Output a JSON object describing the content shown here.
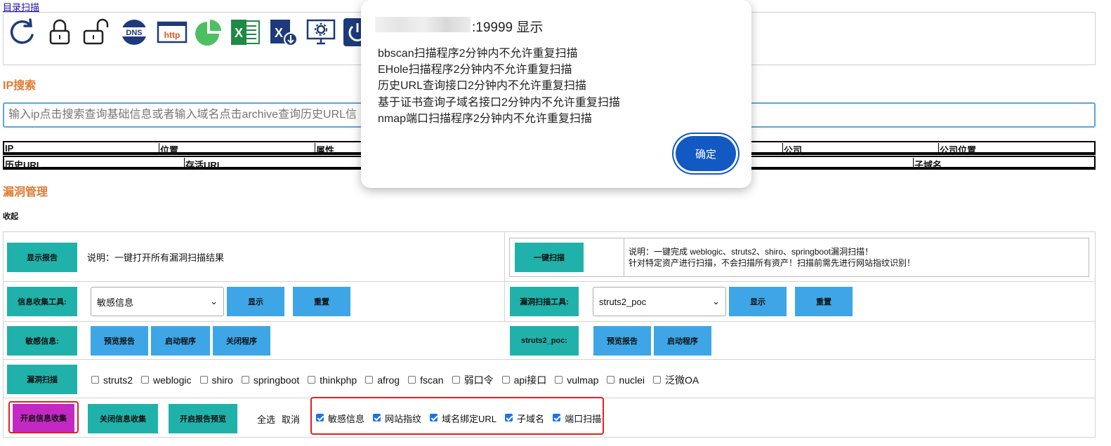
{
  "top_link": "目录扫描",
  "icons": [
    "refresh-icon",
    "unlock-icon",
    "unlock-open-icon",
    "dns-icon",
    "http-icon",
    "pie-chart-icon",
    "excel-icon",
    "excel-export-icon",
    "monitor-settings-icon",
    "power-icon"
  ],
  "ip_search": {
    "title": "IP搜索",
    "placeholder": "输入ip点击搜索查询基础信息或者输入域名点击archive查询历史URL信"
  },
  "table1": {
    "headers": [
      "IP",
      "位置",
      "属性",
      "公司",
      "公司位置"
    ]
  },
  "table2": {
    "headers": [
      "历史URL",
      "存活URL",
      "子域名"
    ]
  },
  "vuln": {
    "title": "漏洞管理",
    "collapse": "收起",
    "show_report": "显示报告",
    "show_report_desc": "说明：一键打开所有漏洞扫描结果",
    "one_click_scan": "一键扫描",
    "one_click_desc_1": "说明：一键完成 weblogic、struts2、shiro、springboot漏洞扫描！",
    "one_click_desc_2": "针对特定资产进行扫描，不会扫描所有资产！扫描前需先进行网站指纹识别！",
    "info_tool_label": "信息收集工具:",
    "info_tool_selected": "敏感信息",
    "show": "显示",
    "reset": "重置",
    "vuln_tool_label": "漏洞扫描工具:",
    "vuln_tool_selected": "struts2_poc",
    "sensitive_label": "敏感信息:",
    "preview_report": "预览报告",
    "start_program": "启动程序",
    "close_program": "关闭程序",
    "struts2_label": "struts2_poc:",
    "vuln_scan_label": "漏洞扫描",
    "vuln_options": [
      "struts2",
      "weblogic",
      "shiro",
      "springboot",
      "thinkphp",
      "afrog",
      "fscan",
      "弱口令",
      "api接口",
      "vulmap",
      "nuclei",
      "泛微OA"
    ],
    "start_collect": "开启信息收集",
    "stop_collect": "关闭信息收集",
    "start_preview": "开启报告预览",
    "select_all": "全选",
    "cancel": "取消",
    "collect_options": [
      "敏感信息",
      "网站指纹",
      "域名绑定URL",
      "子域名",
      "端口扫描"
    ]
  },
  "dialog": {
    "title_suffix": ":19999 显示",
    "lines": [
      "bbscan扫描程序2分钟内不允许重复扫描",
      "EHole扫描程序2分钟内不允许重复扫描",
      "历史URL查询接口2分钟内不允许重复扫描",
      "基于证书查询子域名接口2分钟内不允许重复扫描",
      "nmap端口扫描程序2分钟内不允许重复扫描"
    ],
    "ok": "确定"
  },
  "colors": {
    "teal": "#20b2aa",
    "blue": "#3ea6e6",
    "purple": "#c428c4",
    "title_orange": "#e07a33",
    "dialog_button": "#1259c3",
    "highlight_red": "#e02020"
  }
}
